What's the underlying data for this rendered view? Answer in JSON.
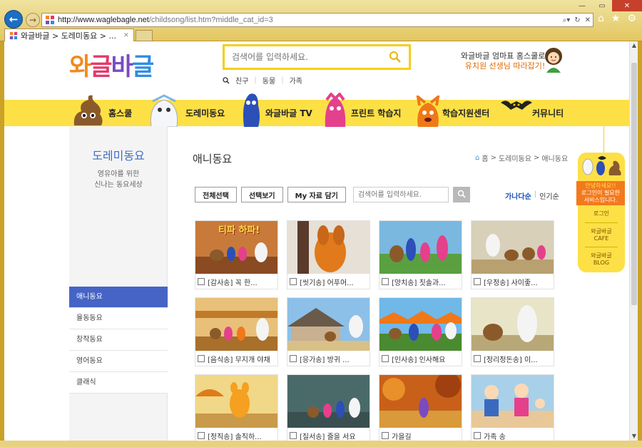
{
  "browser": {
    "url_host": "http://www.waglebagle.net",
    "url_path": "/childsong/list.htm?middle_cat_id=3",
    "tab_title": "와글바글 > 도레미동요 > ..."
  },
  "header": {
    "logo": [
      "와",
      "글",
      "바",
      "글"
    ],
    "search_placeholder": "검색어를 입력하세요.",
    "keywords": [
      "친구",
      "동물",
      "가족"
    ],
    "promo_line1": "와글바글 엄마표 홈스쿨로",
    "promo_line2": "유치원 선생님 따라잡기!"
  },
  "nav": [
    "홈스쿨",
    "도레미동요",
    "와글바글 TV",
    "프린트 학습지",
    "학습지원센터",
    "커뮤니티"
  ],
  "sidebar": {
    "title": "도레미동요",
    "subtitle_1": "영유아를 위한",
    "subtitle_2": "신나는 동요세상",
    "items": [
      "애니동요",
      "율동동요",
      "창작동요",
      "영어동요",
      "클래식"
    ]
  },
  "content": {
    "title": "애니동요",
    "breadcrumb": [
      "홈",
      "도레미동요",
      "애니동요"
    ],
    "toolbar": {
      "select_all": "전체선택",
      "play_selected": "선택보기",
      "save": "My 자료 담기",
      "search_placeholder": "검색어를 입력하세요."
    },
    "sort": {
      "abc": "가나다순",
      "popular": "인기순"
    },
    "videos": [
      {
        "title": "[감사송] 꼭 한...",
        "overlay": "티파 하파!"
      },
      {
        "title": "[씻기송] 어푸어..."
      },
      {
        "title": "[양치송] 칫솔과..."
      },
      {
        "title": "[우정송] 사이좋..."
      },
      {
        "title": "[음식송] 무지개 야채"
      },
      {
        "title": "[응가송] 방귀 ..."
      },
      {
        "title": "[인사송] 인사해요"
      },
      {
        "title": "[정리정돈송] 이..."
      },
      {
        "title": "[정직송] 솔직하..."
      },
      {
        "title": "[질서송] 줄을 서요"
      },
      {
        "title": "가을길"
      },
      {
        "title": "가족 송"
      }
    ]
  },
  "quick": {
    "alert_1": "안녕하세요!!",
    "alert_2": "로그인이 필요한",
    "alert_3": "서비스입니다.",
    "login": "로그인",
    "cafe_1": "와글바글",
    "cafe_2": "CAFE",
    "blog_1": "와글바글",
    "blog_2": "BLOG"
  },
  "colors": {
    "accent": "#fde046",
    "active": "#4564c6",
    "link_blue": "#1b4fb8"
  }
}
